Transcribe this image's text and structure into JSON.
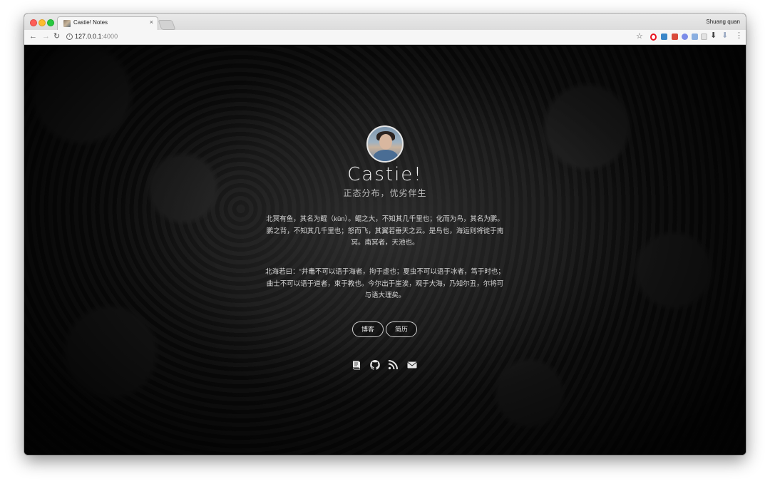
{
  "browser": {
    "tab_title": "Castie! Notes",
    "tab_close": "×",
    "profile_name": "Shuang quan",
    "url_host": "127.0.0.1",
    "url_port": ":4000",
    "icons": {
      "back": "←",
      "forward": "→",
      "reload": "↻",
      "info": "i",
      "star": "☆",
      "menu": "⋮",
      "download": "⬇"
    }
  },
  "site": {
    "title": "Castie!",
    "subtitle": "正态分布，优劣伴生",
    "paragraphs": [
      "北冥有鱼，其名为鲲（kūn）。鲲之大，不知其几千里也；化而为鸟，其名为鹏。鹏之背，不知其几千里也；怒而飞，其翼若垂天之云。是鸟也，海运则将徙于南冥。南冥者，天池也。",
      "北海若曰：“井鼃不可以语于海者，拘于虚也；夏虫不可以语于冰者，笃于时也；曲士不可以语于道者，束于教也。今尔出于崖涘，观于大海，乃知尔丑，尔将可与语大理矣。"
    ],
    "buttons": {
      "blog": "博客",
      "resume": "简历"
    },
    "social_icons": [
      "book-icon",
      "github-icon",
      "rss-icon",
      "mail-icon"
    ]
  },
  "colors": {
    "background": "#0a0a0a",
    "text": "#d8d8d8",
    "title": "#f2f2f2"
  }
}
